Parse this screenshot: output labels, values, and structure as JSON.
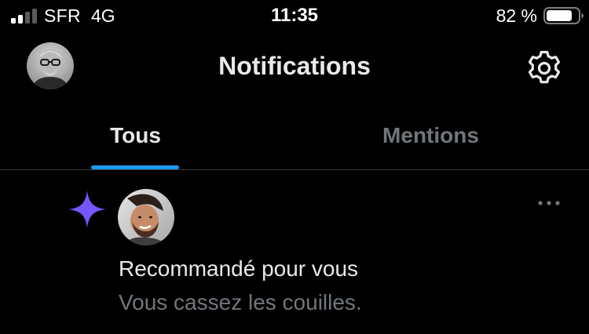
{
  "status_bar": {
    "carrier": "SFR",
    "network": "4G",
    "time": "11:35",
    "battery_percent": "82 %",
    "battery_level": 0.82,
    "signal_bars_active": 2,
    "signal_bars_total": 4
  },
  "header": {
    "title": "Notifications",
    "profile_icon": "avatar",
    "settings_icon": "gear-icon"
  },
  "tabs": [
    {
      "label": "Tous",
      "active": true
    },
    {
      "label": "Mentions",
      "active": false
    }
  ],
  "notification": {
    "type_icon": "sparkle-icon",
    "title": "Recommandé pour vous",
    "text": "Vous cassez les couilles.",
    "more_icon": "more-icon"
  },
  "colors": {
    "background": "#000000",
    "primary_text": "#e7e9ea",
    "secondary_text": "#71767b",
    "accent_blue": "#1d9bf0",
    "sparkle_purple": "#7856ff",
    "divider": "#3a3d40"
  }
}
